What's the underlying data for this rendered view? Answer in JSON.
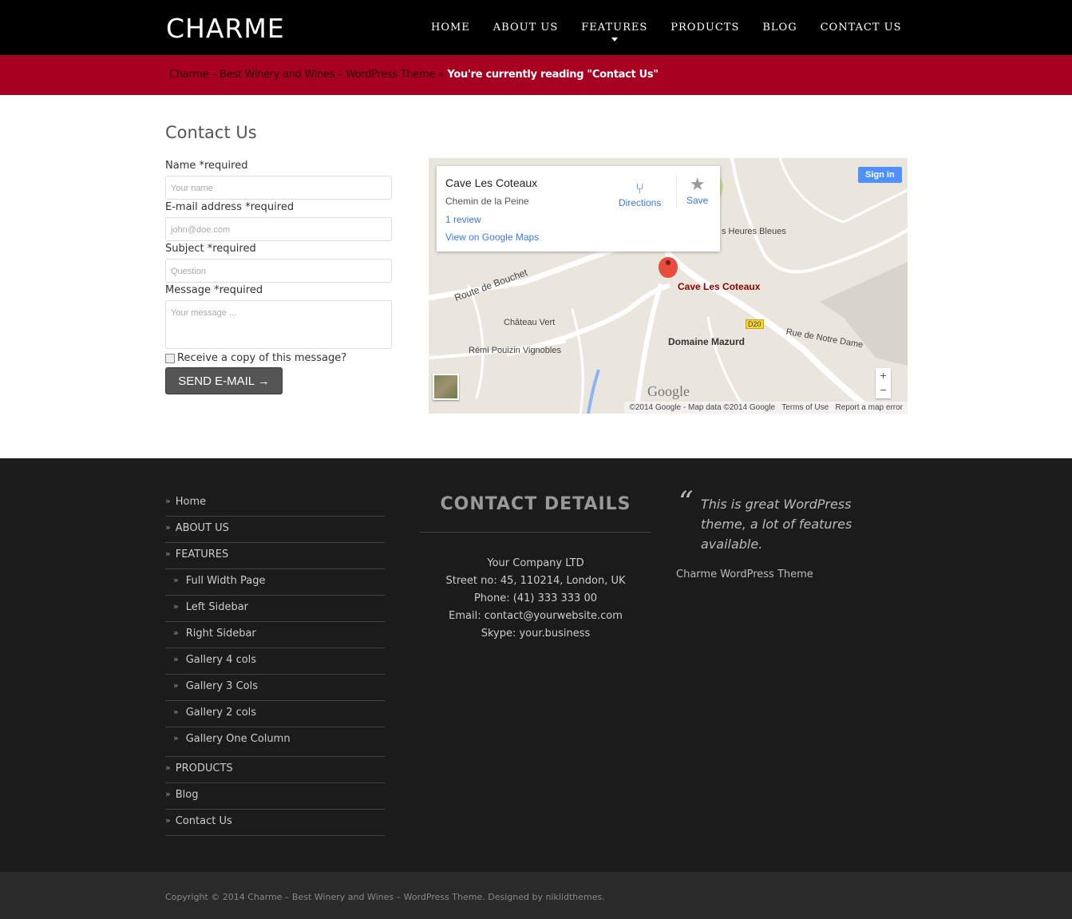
{
  "header": {
    "logo": "CHARME",
    "nav": [
      "HOME",
      "ABOUT US",
      "FEATURES",
      "PRODUCTS",
      "BLOG",
      "CONTACT US"
    ]
  },
  "breadcrumb": {
    "trail": "Charme – Best Winery and Wines – WordPress Theme",
    "sep": " » ",
    "current": "You're currently reading \"Contact Us\""
  },
  "page_title": "Contact Us",
  "form": {
    "name_label": "Name *required",
    "name_placeholder": "Your name",
    "email_label": "E-mail address *required",
    "email_placeholder": "john@doe.com",
    "subject_label": "Subject *required",
    "subject_placeholder": "Question",
    "message_label": "Message *required",
    "message_placeholder": "Your message ...",
    "copy_label": "Receive a copy of this message?",
    "send_label": "SEND E-MAIL →"
  },
  "map": {
    "place": "Cave Les Coteaux",
    "address": "Chemin de la Peine",
    "reviews": "1 review",
    "view_link": "View on Google Maps",
    "directions": "Directions",
    "save": "Save",
    "sign_in": "Sign in",
    "labels": {
      "heures": "s Heures Bleues",
      "route": "Route de Bouchet",
      "chateau": "Château Vert",
      "remi": "Rémi Pouizin Vignobles",
      "domaine": "Domaine Mazurd",
      "rue": "Rue de Notre Dame",
      "d20": "D20",
      "google": "Google"
    },
    "zoom_in": "+",
    "zoom_out": "−",
    "attribution": "©2014 Google - Map data ©2014 Google",
    "terms": "Terms of Use",
    "report": "Report a map error"
  },
  "footer": {
    "menu": [
      {
        "label": "Home",
        "sub": false
      },
      {
        "label": "ABOUT US",
        "sub": false
      },
      {
        "label": "FEATURES",
        "sub": false
      },
      {
        "label": "Full Width Page",
        "sub": true
      },
      {
        "label": "Left Sidebar",
        "sub": true
      },
      {
        "label": "Right Sidebar",
        "sub": true
      },
      {
        "label": "Gallery 4 cols",
        "sub": true
      },
      {
        "label": "Gallery 3 Cols",
        "sub": true
      },
      {
        "label": "Gallery 2 cols",
        "sub": true
      },
      {
        "label": "Gallery One Column",
        "sub": true
      },
      {
        "label": "PRODUCTS",
        "sub": false
      },
      {
        "label": "Blog",
        "sub": false
      },
      {
        "label": "Contact Us",
        "sub": false
      }
    ],
    "contact_title": "CONTACT DETAILS",
    "contact": [
      "Your Company LTD",
      "Street no: 45, 110214, London, UK",
      "Phone: (41) 333 333 00",
      "Email: contact@yourwebsite.com",
      "Skype: your.business"
    ],
    "quote": "This is great WordPress theme, a lot of features available.",
    "quote_author": "Charme WordPress Theme",
    "copyright": "Copyright © 2014 Charme – Best Winery and Wines – WordPress Theme. Designed by niklidthemes."
  }
}
